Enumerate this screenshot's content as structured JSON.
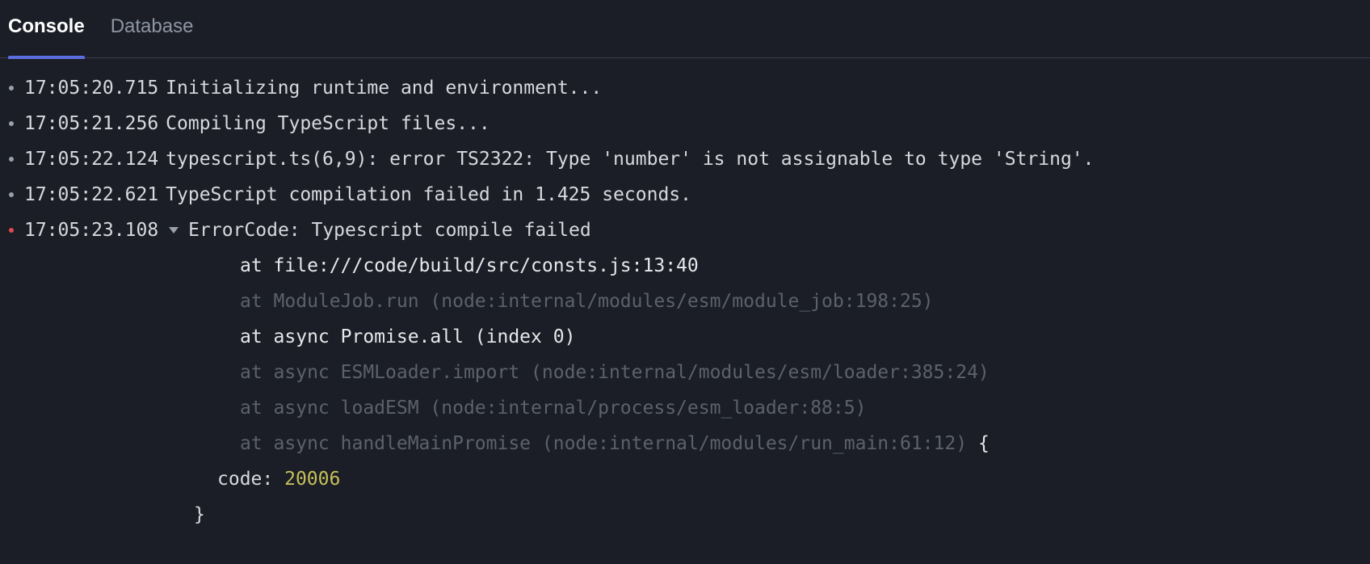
{
  "tabs": [
    {
      "label": "Console",
      "active": true
    },
    {
      "label": "Database",
      "active": false
    }
  ],
  "logs": [
    {
      "time": "17:05:20.715",
      "message": "Initializing runtime and environment...",
      "level": "info"
    },
    {
      "time": "17:05:21.256",
      "message": "Compiling TypeScript files...",
      "level": "info"
    },
    {
      "time": "17:05:22.124",
      "message": "typescript.ts(6,9): error TS2322: Type 'number' is not assignable to type 'String'.",
      "level": "info"
    },
    {
      "time": "17:05:22.621",
      "message": "TypeScript compilation failed in 1.425 seconds.",
      "level": "info"
    },
    {
      "time": "17:05:23.108",
      "message": "ErrorCode: Typescript compile failed",
      "level": "error"
    }
  ],
  "error": {
    "stack": [
      {
        "text": "at file:///code/build/src/consts.js:13:40",
        "dim": false
      },
      {
        "text": "at ModuleJob.run (node:internal/modules/esm/module_job:198:25)",
        "dim": true
      },
      {
        "text": "at async Promise.all (index 0)",
        "dim": false
      },
      {
        "text": "at async ESMLoader.import (node:internal/modules/esm/loader:385:24)",
        "dim": true
      },
      {
        "text": "at async loadESM (node:internal/process/esm_loader:88:5)",
        "dim": true
      },
      {
        "text": "at async handleMainPromise (node:internal/modules/run_main:61:12)",
        "dim": true
      }
    ],
    "open_brace": "{",
    "code_key": "code: ",
    "code_value": "20006",
    "close_brace": "}"
  },
  "colors": {
    "background": "#1b1e26",
    "accent": "#5b6ee1",
    "error_bullet": "#e5484d",
    "number": "#c6c05a"
  }
}
